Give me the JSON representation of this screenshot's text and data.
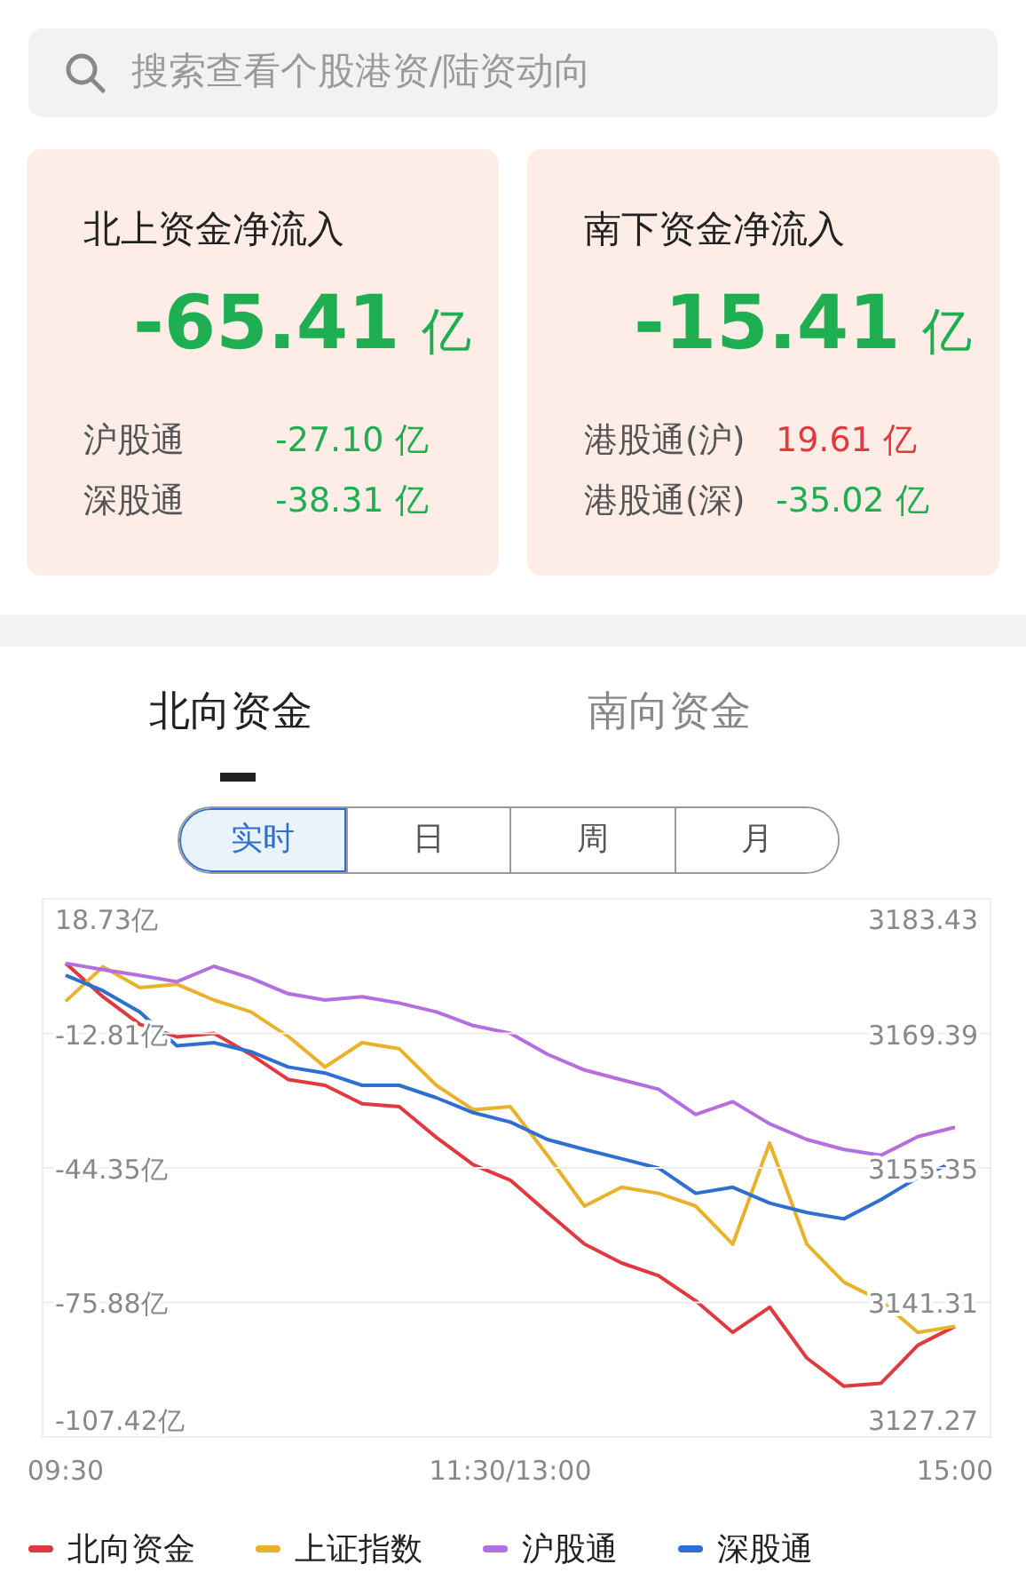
{
  "search": {
    "placeholder": "搜索查看个股港资/陆资动向"
  },
  "summary_cards": [
    {
      "title": "北上资金净流入",
      "value": "-65.41",
      "unit": "亿",
      "color": "#1fae52",
      "rows": [
        {
          "label": "沪股通",
          "value": "-27.10 亿",
          "color": "#1fae52"
        },
        {
          "label": "深股通",
          "value": "-38.31 亿",
          "color": "#1fae52"
        }
      ]
    },
    {
      "title": "南下资金净流入",
      "value": "-15.41",
      "unit": "亿",
      "color": "#1fae52",
      "rows": [
        {
          "label": "港股通(沪)",
          "value": "19.61 亿",
          "color": "#e0393e"
        },
        {
          "label": "港股通(深)",
          "value": "-35.02 亿",
          "color": "#1fae52"
        }
      ]
    }
  ],
  "tabs": [
    {
      "label": "北向资金",
      "selected": true
    },
    {
      "label": "南向资金",
      "selected": false
    }
  ],
  "periods": [
    {
      "label": "实时",
      "selected": true
    },
    {
      "label": "日",
      "selected": false
    },
    {
      "label": "周",
      "selected": false
    },
    {
      "label": "月",
      "selected": false
    }
  ],
  "chart": {
    "right_axis_labels": [
      "3183.43",
      "3169.39",
      "3155.35",
      "3141.31",
      "3127.27"
    ],
    "chart_data": {
      "type": "line",
      "categories": [
        "09:30",
        null,
        null,
        null,
        null,
        null,
        null,
        null,
        null,
        null,
        null,
        null,
        "11:30/13:00",
        null,
        null,
        null,
        null,
        null,
        null,
        null,
        null,
        null,
        null,
        null,
        "15:00"
      ],
      "ylim": [
        -107.42,
        18.73
      ],
      "grid": true,
      "yticks": [
        {
          "value": 18.73,
          "label": "18.73亿"
        },
        {
          "value": -12.81,
          "label": "-12.81亿"
        },
        {
          "value": -44.35,
          "label": "-44.35亿"
        },
        {
          "value": -75.88,
          "label": "-75.88亿"
        },
        {
          "value": -107.42,
          "label": "-107.42亿"
        }
      ],
      "series": [
        {
          "name": "北向资金",
          "color": "#e0393e",
          "values": [
            3.6,
            -4.2,
            -10.7,
            -13.6,
            -12.8,
            -17.8,
            -23.6,
            -25.0,
            -29.3,
            -30.0,
            -37.2,
            -43.6,
            -47.2,
            -54.8,
            -62.2,
            -66.6,
            -69.6,
            -75.5,
            -82.9,
            -77.0,
            -88.9,
            -95.5,
            -94.8,
            -85.9,
            -81.5
          ]
        },
        {
          "name": "上证指数",
          "color": "#e8b32a",
          "values": [
            -5.3,
            2.8,
            -2.1,
            -1.3,
            -5.0,
            -7.8,
            -13.5,
            -20.7,
            -15.0,
            -16.4,
            -25.0,
            -30.7,
            -30.0,
            -41.4,
            -53.3,
            -48.9,
            -50.3,
            -53.3,
            -62.2,
            -38.5,
            -62.2,
            -71.1,
            -75.5,
            -82.9,
            -81.5
          ]
        },
        {
          "name": "沪股通",
          "color": "#b46ee0",
          "values": [
            3.6,
            2.1,
            0.8,
            -0.7,
            2.9,
            0.1,
            -3.5,
            -5.0,
            -4.2,
            -5.7,
            -7.8,
            -11.0,
            -12.8,
            -17.7,
            -21.4,
            -23.7,
            -25.9,
            -31.8,
            -28.8,
            -34.0,
            -37.7,
            -40.0,
            -41.4,
            -37.0,
            -34.8
          ]
        },
        {
          "name": "深股通",
          "color": "#2f6fd0",
          "values": [
            0.8,
            -2.8,
            -7.8,
            -15.7,
            -15.0,
            -17.1,
            -20.7,
            -22.1,
            -25.0,
            -25.0,
            -27.9,
            -31.4,
            -33.6,
            -37.7,
            -40.0,
            -42.2,
            -44.4,
            -50.3,
            -48.9,
            -52.6,
            -54.8,
            -56.3,
            -51.8,
            -46.6,
            -42.9
          ]
        }
      ]
    }
  }
}
